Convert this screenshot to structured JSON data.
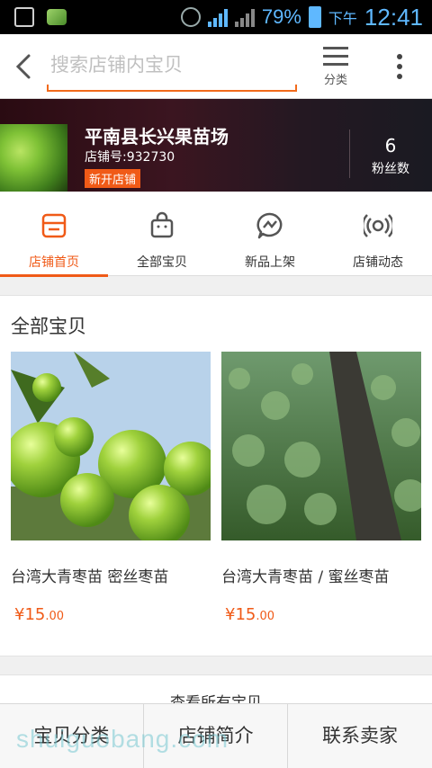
{
  "status_bar": {
    "battery_percent": "79%",
    "am_pm": "下午",
    "time": "12:41",
    "accent": "#5fb8ff"
  },
  "header": {
    "search_placeholder": "搜索店铺内宝贝",
    "category_label": "分类",
    "accent": "#f26a1b"
  },
  "shop": {
    "name": "平南县长兴果苗场",
    "id_text": "店铺号:932730",
    "tag": "新开店铺",
    "fans_count": "6",
    "fans_label": "粉丝数"
  },
  "tabs": [
    {
      "label": "店铺首页",
      "icon": "store-icon",
      "active": true
    },
    {
      "label": "全部宝贝",
      "icon": "bag-icon",
      "active": false
    },
    {
      "label": "新品上架",
      "icon": "new-arrival-icon",
      "active": false
    },
    {
      "label": "店铺动态",
      "icon": "broadcast-icon",
      "active": false
    }
  ],
  "section": {
    "title": "全部宝贝",
    "products": [
      {
        "name": "台湾大青枣苗  密丝枣苗",
        "price_symbol": "¥",
        "price_int": "15",
        "price_dec": ".00"
      },
      {
        "name": "台湾大青枣苗 / 蜜丝枣苗",
        "price_symbol": "¥",
        "price_int": "15",
        "price_dec": ".00"
      }
    ]
  },
  "view_all": "查看所有宝贝",
  "bottom_nav": [
    "宝贝分类",
    "店铺简介",
    "联系卖家"
  ],
  "watermark": "shuiguobang.com"
}
